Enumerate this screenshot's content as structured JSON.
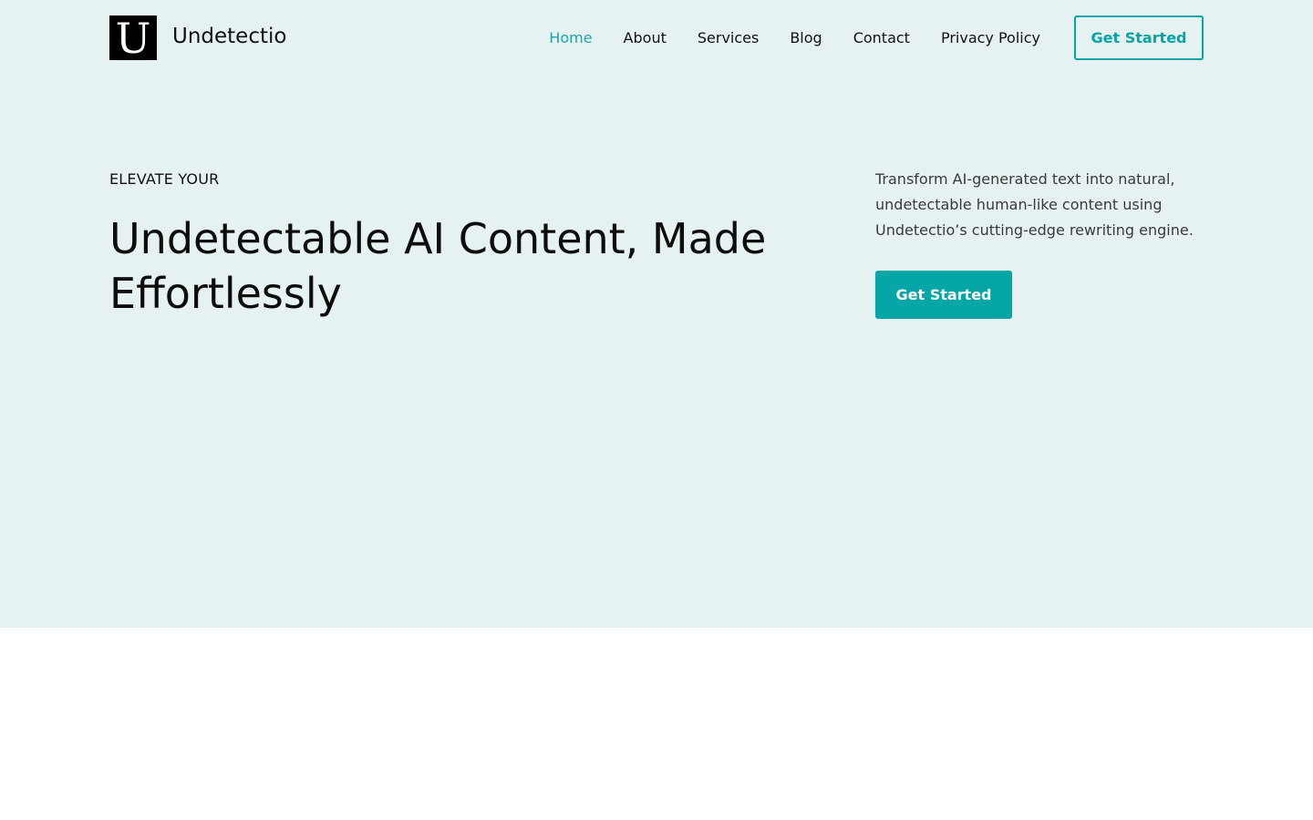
{
  "colors": {
    "hero_background": "#e6f2f2",
    "accent": "#06a5a6",
    "nav_active": "#1aa6a8",
    "page_background": "#ffffff"
  },
  "header": {
    "logo_letter": "U",
    "brand_name": "Undetectio",
    "nav": [
      {
        "label": "Home",
        "active": true
      },
      {
        "label": "About",
        "active": false
      },
      {
        "label": "Services",
        "active": false
      },
      {
        "label": "Blog",
        "active": false
      },
      {
        "label": "Contact",
        "active": false
      },
      {
        "label": "Privacy Policy",
        "active": false
      }
    ],
    "cta_label": "Get Started"
  },
  "hero": {
    "eyebrow": "ELEVATE YOUR",
    "title": "Undetectable AI Content, Made Effortlessly",
    "description": "Transform AI-generated text into natural, undetectable human-like content using Undetectio’s cutting-edge rewriting engine.",
    "cta_label": "Get Started"
  }
}
